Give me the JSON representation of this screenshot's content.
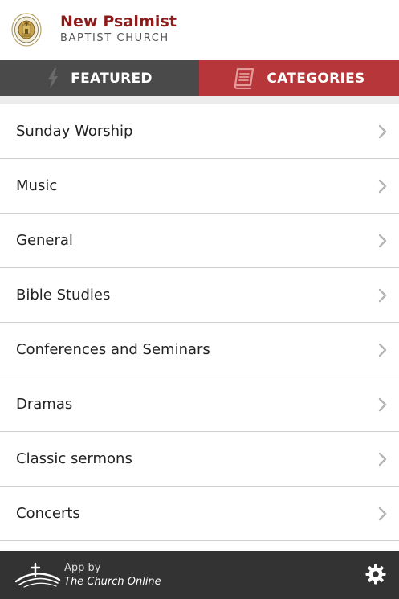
{
  "header": {
    "title": "New Psalmist",
    "subtitle": "BAPTIST CHURCH",
    "logo_icon": "church-seal-icon"
  },
  "tabs": [
    {
      "label": "FEATURED",
      "icon": "lightning-icon",
      "active": false
    },
    {
      "label": "CATEGORIES",
      "icon": "book-icon",
      "active": true
    }
  ],
  "categories": [
    {
      "label": "Sunday Worship"
    },
    {
      "label": "Music"
    },
    {
      "label": "General"
    },
    {
      "label": "Bible Studies"
    },
    {
      "label": "Conferences and Seminars"
    },
    {
      "label": "Dramas"
    },
    {
      "label": "Classic sermons"
    },
    {
      "label": "Concerts"
    }
  ],
  "footer": {
    "line1": "App by",
    "line2": "The Church Online",
    "settings_icon": "gear-icon"
  },
  "colors": {
    "brand_red": "#8e1b1b",
    "active_tab": "#b7363a",
    "inactive_tab": "#4a4a4a",
    "footer_bg": "#333333"
  }
}
